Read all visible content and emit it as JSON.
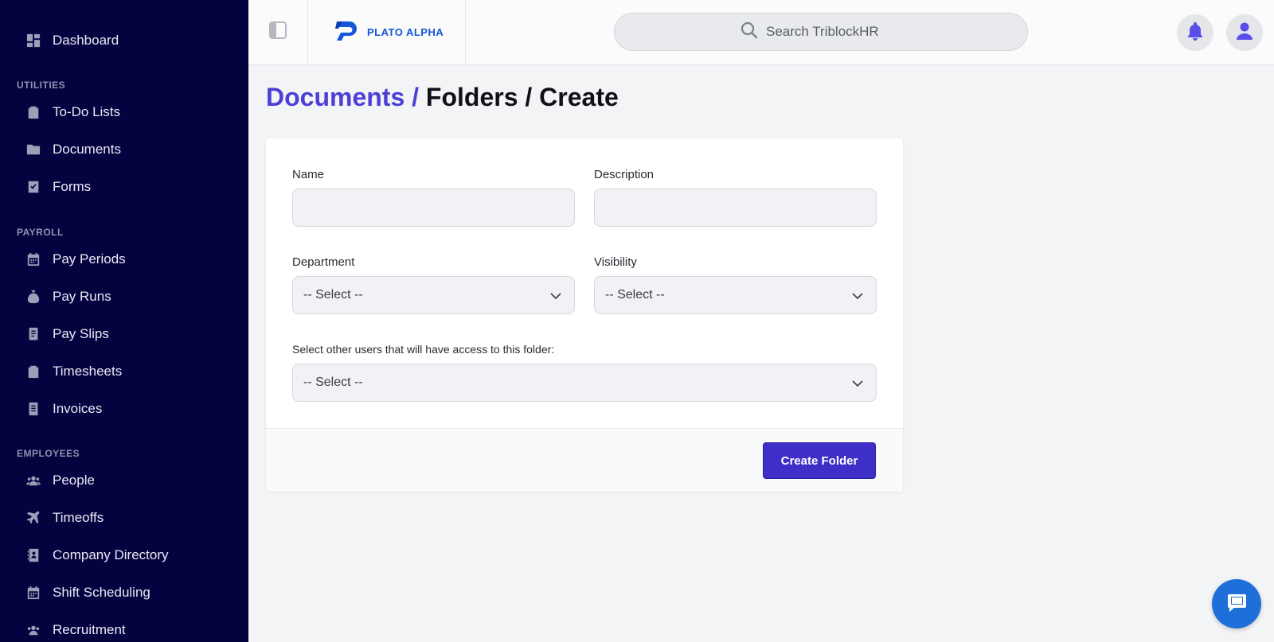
{
  "sidebar": {
    "items": [
      {
        "label": "Dashboard",
        "icon": "dashboard-icon"
      },
      {
        "label": "To-Do Lists",
        "icon": "clipboard-icon"
      },
      {
        "label": "Documents",
        "icon": "folder-icon"
      },
      {
        "label": "Forms",
        "icon": "form-check-icon"
      },
      {
        "label": "Pay Periods",
        "icon": "calendar-icon"
      },
      {
        "label": "Pay Runs",
        "icon": "money-bag-icon"
      },
      {
        "label": "Pay Slips",
        "icon": "receipt-icon"
      },
      {
        "label": "Timesheets",
        "icon": "clipboard-icon"
      },
      {
        "label": "Invoices",
        "icon": "invoice-icon"
      },
      {
        "label": "People",
        "icon": "people-icon"
      },
      {
        "label": "Timeoffs",
        "icon": "plane-icon"
      },
      {
        "label": "Company Directory",
        "icon": "contact-book-icon"
      },
      {
        "label": "Shift Scheduling",
        "icon": "calendar-icon"
      },
      {
        "label": "Recruitment",
        "icon": "people-icon"
      }
    ],
    "sections": {
      "utilities": "UTILITIES",
      "payroll": "PAYROLL",
      "employees": "EMPLOYEES"
    }
  },
  "topbar": {
    "logo_text": "PLATO ALPHA",
    "search_placeholder": "Search TriblockHR"
  },
  "breadcrumb": {
    "link": "Documents",
    "separator": " / ",
    "rest": "Folders / Create"
  },
  "form": {
    "name_label": "Name",
    "description_label": "Description",
    "department_label": "Department",
    "department_value": "-- Select --",
    "visibility_label": "Visibility",
    "visibility_value": "-- Select --",
    "users_label": "Select other users that will have access to this folder:",
    "users_value": "-- Select --",
    "submit_label": "Create Folder"
  },
  "colors": {
    "sidebar_bg": "#04033f",
    "accent": "#4b3fd6",
    "button": "#3e2fc8",
    "logo": "#1456d8",
    "chat": "#1e6fd9"
  }
}
